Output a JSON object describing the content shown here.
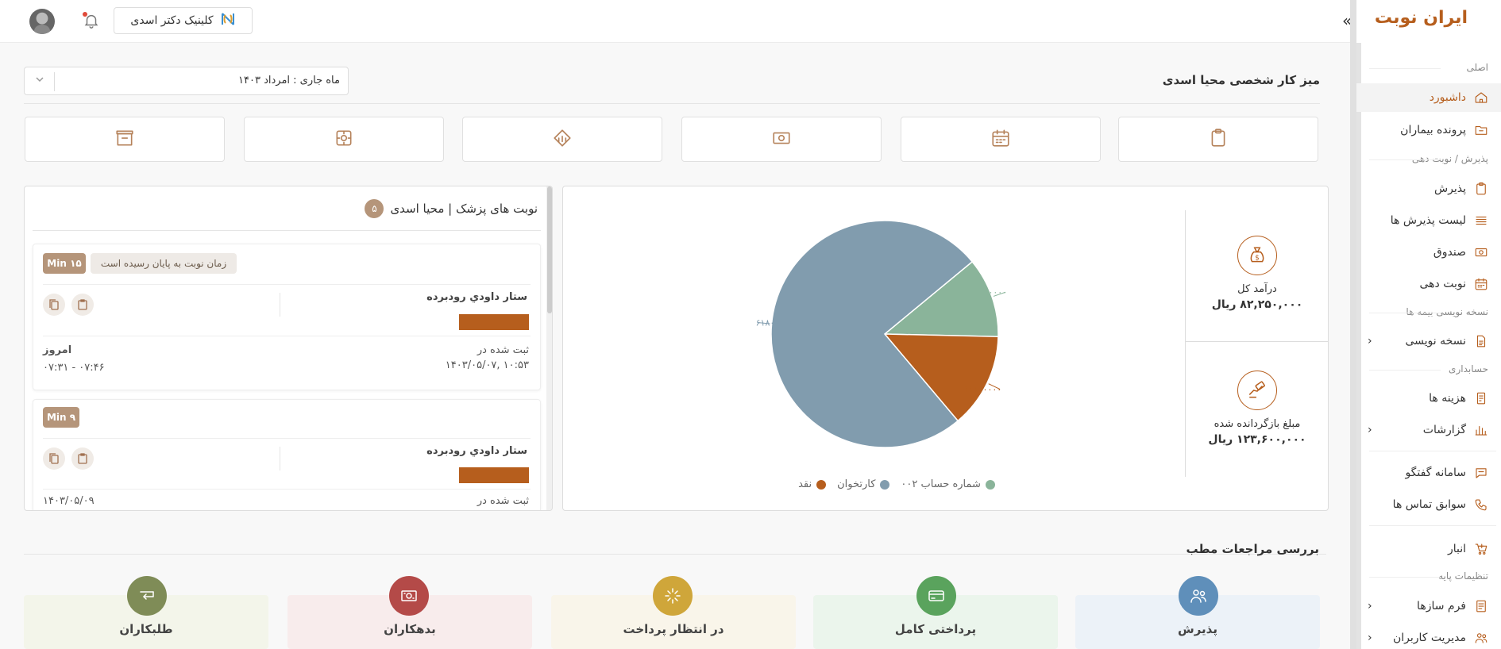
{
  "app": {
    "logo": "ایران نوبت",
    "clinic_label": "کلینیک دکتر اسدی",
    "clinic_icon": "clinic-logo-icon"
  },
  "topbar": {
    "collapse_glyph": "»"
  },
  "sidebar": {
    "sections": {
      "main": "اصلی",
      "reception": "پذیرش / نوبت دهی",
      "insurance": "نسخه نویسی بیمه ها",
      "accounting": "حسابداری",
      "settings": "تنظیمات پایه"
    },
    "items": [
      {
        "label": "داشبورد",
        "icon": "home-icon",
        "active": true
      },
      {
        "label": "پرونده بیماران",
        "icon": "folder-icon"
      },
      {
        "label": "پذیرش",
        "icon": "clipboard-icon"
      },
      {
        "label": "لیست پذیرش ها",
        "icon": "list-icon"
      },
      {
        "label": "صندوق",
        "icon": "cash-icon"
      },
      {
        "label": "نوبت دهی",
        "icon": "calendar-icon"
      },
      {
        "label": "نسخه نویسی",
        "icon": "document-icon",
        "chevron": "‹"
      },
      {
        "label": "هزینه ها",
        "icon": "receipt-icon"
      },
      {
        "label": "گزارشات",
        "icon": "bar-chart-icon",
        "chevron": "‹"
      },
      {
        "label": "سامانه گفتگو",
        "icon": "chat-icon"
      },
      {
        "label": "سوابق تماس ها",
        "icon": "phone-icon"
      },
      {
        "label": "انبار",
        "icon": "cart-icon"
      },
      {
        "label": "فرم سازها",
        "icon": "form-icon",
        "chevron": "‹"
      },
      {
        "label": "مدیریت کاربران",
        "icon": "users-icon",
        "chevron": "‹"
      }
    ]
  },
  "desk": {
    "title": "میز کار شخصی محیا اسدی",
    "month_select": "ماه جاری : امرداد ۱۴۰۳"
  },
  "quick_actions": [
    "clipboard-icon",
    "calendar-icon",
    "cash-icon",
    "bank-icon",
    "gear-icon",
    "archive-icon"
  ],
  "stats": {
    "income": {
      "label": "درآمد کل",
      "value": "۸۲,۲۵۰,۰۰۰ ریال"
    },
    "refund": {
      "label": "مبلغ بازگردانده شده",
      "value": "۱۲۳,۶۰۰,۰۰۰ ریال"
    }
  },
  "chart_data": {
    "type": "pie",
    "slices": [
      {
        "name": "شماره حساب ۰۰۲",
        "value": 9350000,
        "label": "۹۳۵۰۰۰۰",
        "color": "#8ab49a"
      },
      {
        "name": "نقد",
        "value": 11100000,
        "label": "۱۱۱۰۰۰۰۰",
        "color": "#b65e1d"
      },
      {
        "name": "کارتخوان",
        "value": 61800000,
        "label": "۶۱۸۰۰۰۰۰",
        "color": "#819cae"
      }
    ],
    "legend": [
      "شماره حساب ۰۰۲",
      "کارتخوان",
      "نقد"
    ]
  },
  "appointments": {
    "title": "نوبت های پزشک | محیا اسدی",
    "count": "۵",
    "cards": [
      {
        "duration": "۱۵ Min",
        "status": "زمان نوبت به پایان رسیده است",
        "doctor": "ستار داودي رودبرده",
        "registered_label": "ثبت شده در",
        "registered_at": "۱۴۰۳/۰۵/۰۷, ۱۰:۵۳",
        "day": "امروز",
        "time": "۰۷:۳۱ - ۰۷:۴۶"
      },
      {
        "duration": "۹ Min",
        "doctor": "ستار داودي رودبرده",
        "registered_label": "ثبت شده در",
        "date": "۱۴۰۳/۰۵/۰۹"
      }
    ]
  },
  "review": {
    "title": "بررسی مراجعات مطب",
    "cards": [
      {
        "label": "پذیرش",
        "icon": "users-icon",
        "color": "#5f8fba",
        "bg": "#ecf2f8"
      },
      {
        "label": "پرداختی کامل",
        "icon": "card-icon",
        "color": "#5aa35d",
        "bg": "#ebf5ec"
      },
      {
        "label": "در انتظار پرداخت",
        "icon": "loading-icon",
        "color": "#cfa63a",
        "bg": "#f9f5ea"
      },
      {
        "label": "بدهکاران",
        "icon": "money-icon",
        "color": "#b44a48",
        "bg": "#f8ecec"
      },
      {
        "label": "طلبکاران",
        "icon": "return-icon",
        "color": "#7f8c57",
        "bg": "#f3f5ea"
      }
    ]
  }
}
